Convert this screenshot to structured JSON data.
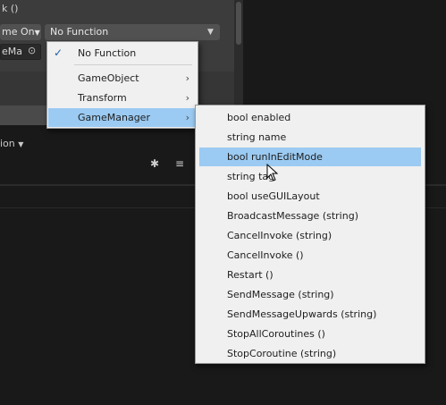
{
  "inspector": {
    "header_fragment": "k ()",
    "runtime_value": "me On",
    "object_value": "eMa",
    "function_value": "No Function",
    "foldout_label": "ion"
  },
  "menu": {
    "items": [
      {
        "label": "No Function",
        "checked": true
      },
      {
        "label": "GameObject",
        "has_submenu": true
      },
      {
        "label": "Transform",
        "has_submenu": true
      },
      {
        "label": "GameManager",
        "has_submenu": true,
        "highlighted": true
      }
    ]
  },
  "submenu": {
    "items": [
      {
        "label": "bool enabled"
      },
      {
        "label": "string name"
      },
      {
        "label": "bool runInEditMode",
        "highlighted": true
      },
      {
        "label": "string tag"
      },
      {
        "label": "bool useGUILayout"
      },
      {
        "label": "BroadcastMessage (string)"
      },
      {
        "label": "CancelInvoke (string)"
      },
      {
        "label": "CancelInvoke ()"
      },
      {
        "label": "Restart ()"
      },
      {
        "label": "SendMessage (string)"
      },
      {
        "label": "SendMessageUpwards (string)"
      },
      {
        "label": "StopAllCoroutines ()"
      },
      {
        "label": "StopCoroutine (string)"
      }
    ]
  },
  "icons": {
    "check": "checkmark-icon",
    "chevron": "chevron-right-icon",
    "dropdown_arrow": "triangle-down-icon",
    "object_picker": "target-icon",
    "debug": "bug-icon",
    "layers": "layers-icon"
  },
  "colors": {
    "highlight": "#9bcaf2",
    "menu_bg": "#f0f0f0",
    "editor_bg": "#191919",
    "panel_bg": "#3c3c3c"
  }
}
